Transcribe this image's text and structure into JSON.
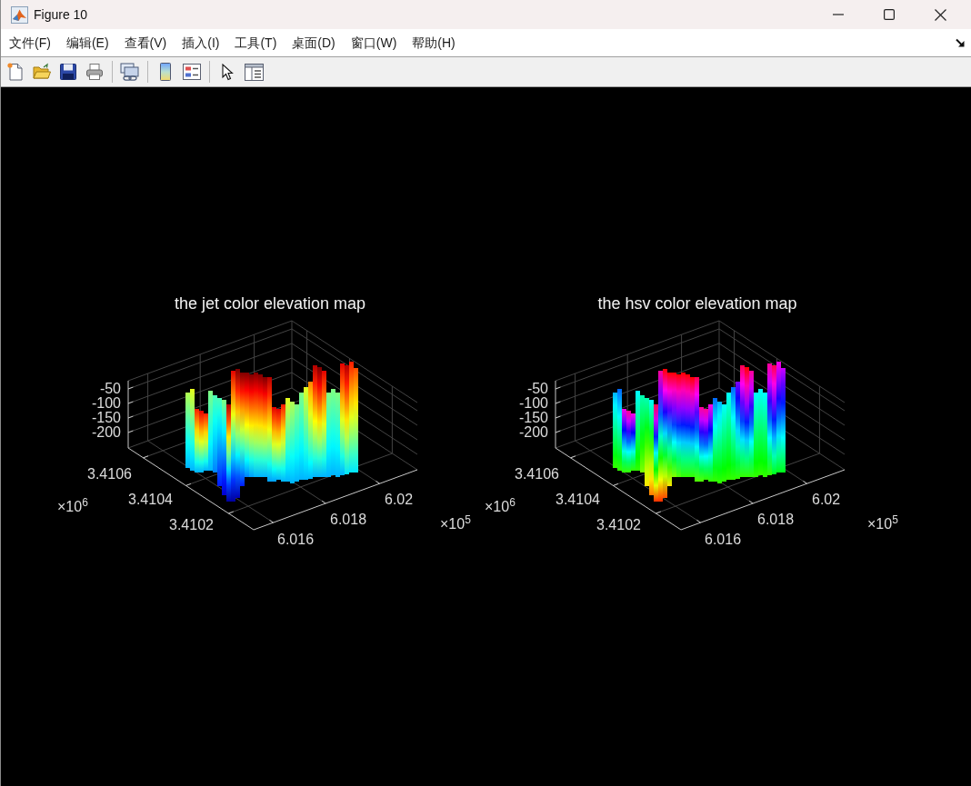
{
  "window": {
    "title": "Figure 10"
  },
  "menu_bar": [
    "文件(F)",
    "编辑(E)",
    "查看(V)",
    "插入(I)",
    "工具(T)",
    "桌面(D)",
    "窗口(W)",
    "帮助(H)"
  ],
  "plots": [
    {
      "kind": "jet",
      "title": "the jet color elevation map",
      "z_ticks": [
        "-50",
        "-100",
        "-150",
        "-200"
      ],
      "y_ticks": [
        "3.4106",
        "3.4104",
        "3.4102"
      ],
      "y_multiplier": "×10$^{6}$",
      "x_ticks": [
        "6.016",
        "6.018",
        "6.02"
      ],
      "x_multiplier": "×10$^{5}$"
    },
    {
      "kind": "hsv",
      "title": "the hsv color elevation map",
      "z_ticks": [
        "-50",
        "-100",
        "-150",
        "-200"
      ],
      "y_ticks": [
        "3.4106",
        "3.4104",
        "3.4102"
      ],
      "y_multiplier": "×10$^{6}$",
      "x_ticks": [
        "6.016",
        "6.018",
        "6.02"
      ],
      "x_multiplier": "×10$^{5}$"
    }
  ]
}
